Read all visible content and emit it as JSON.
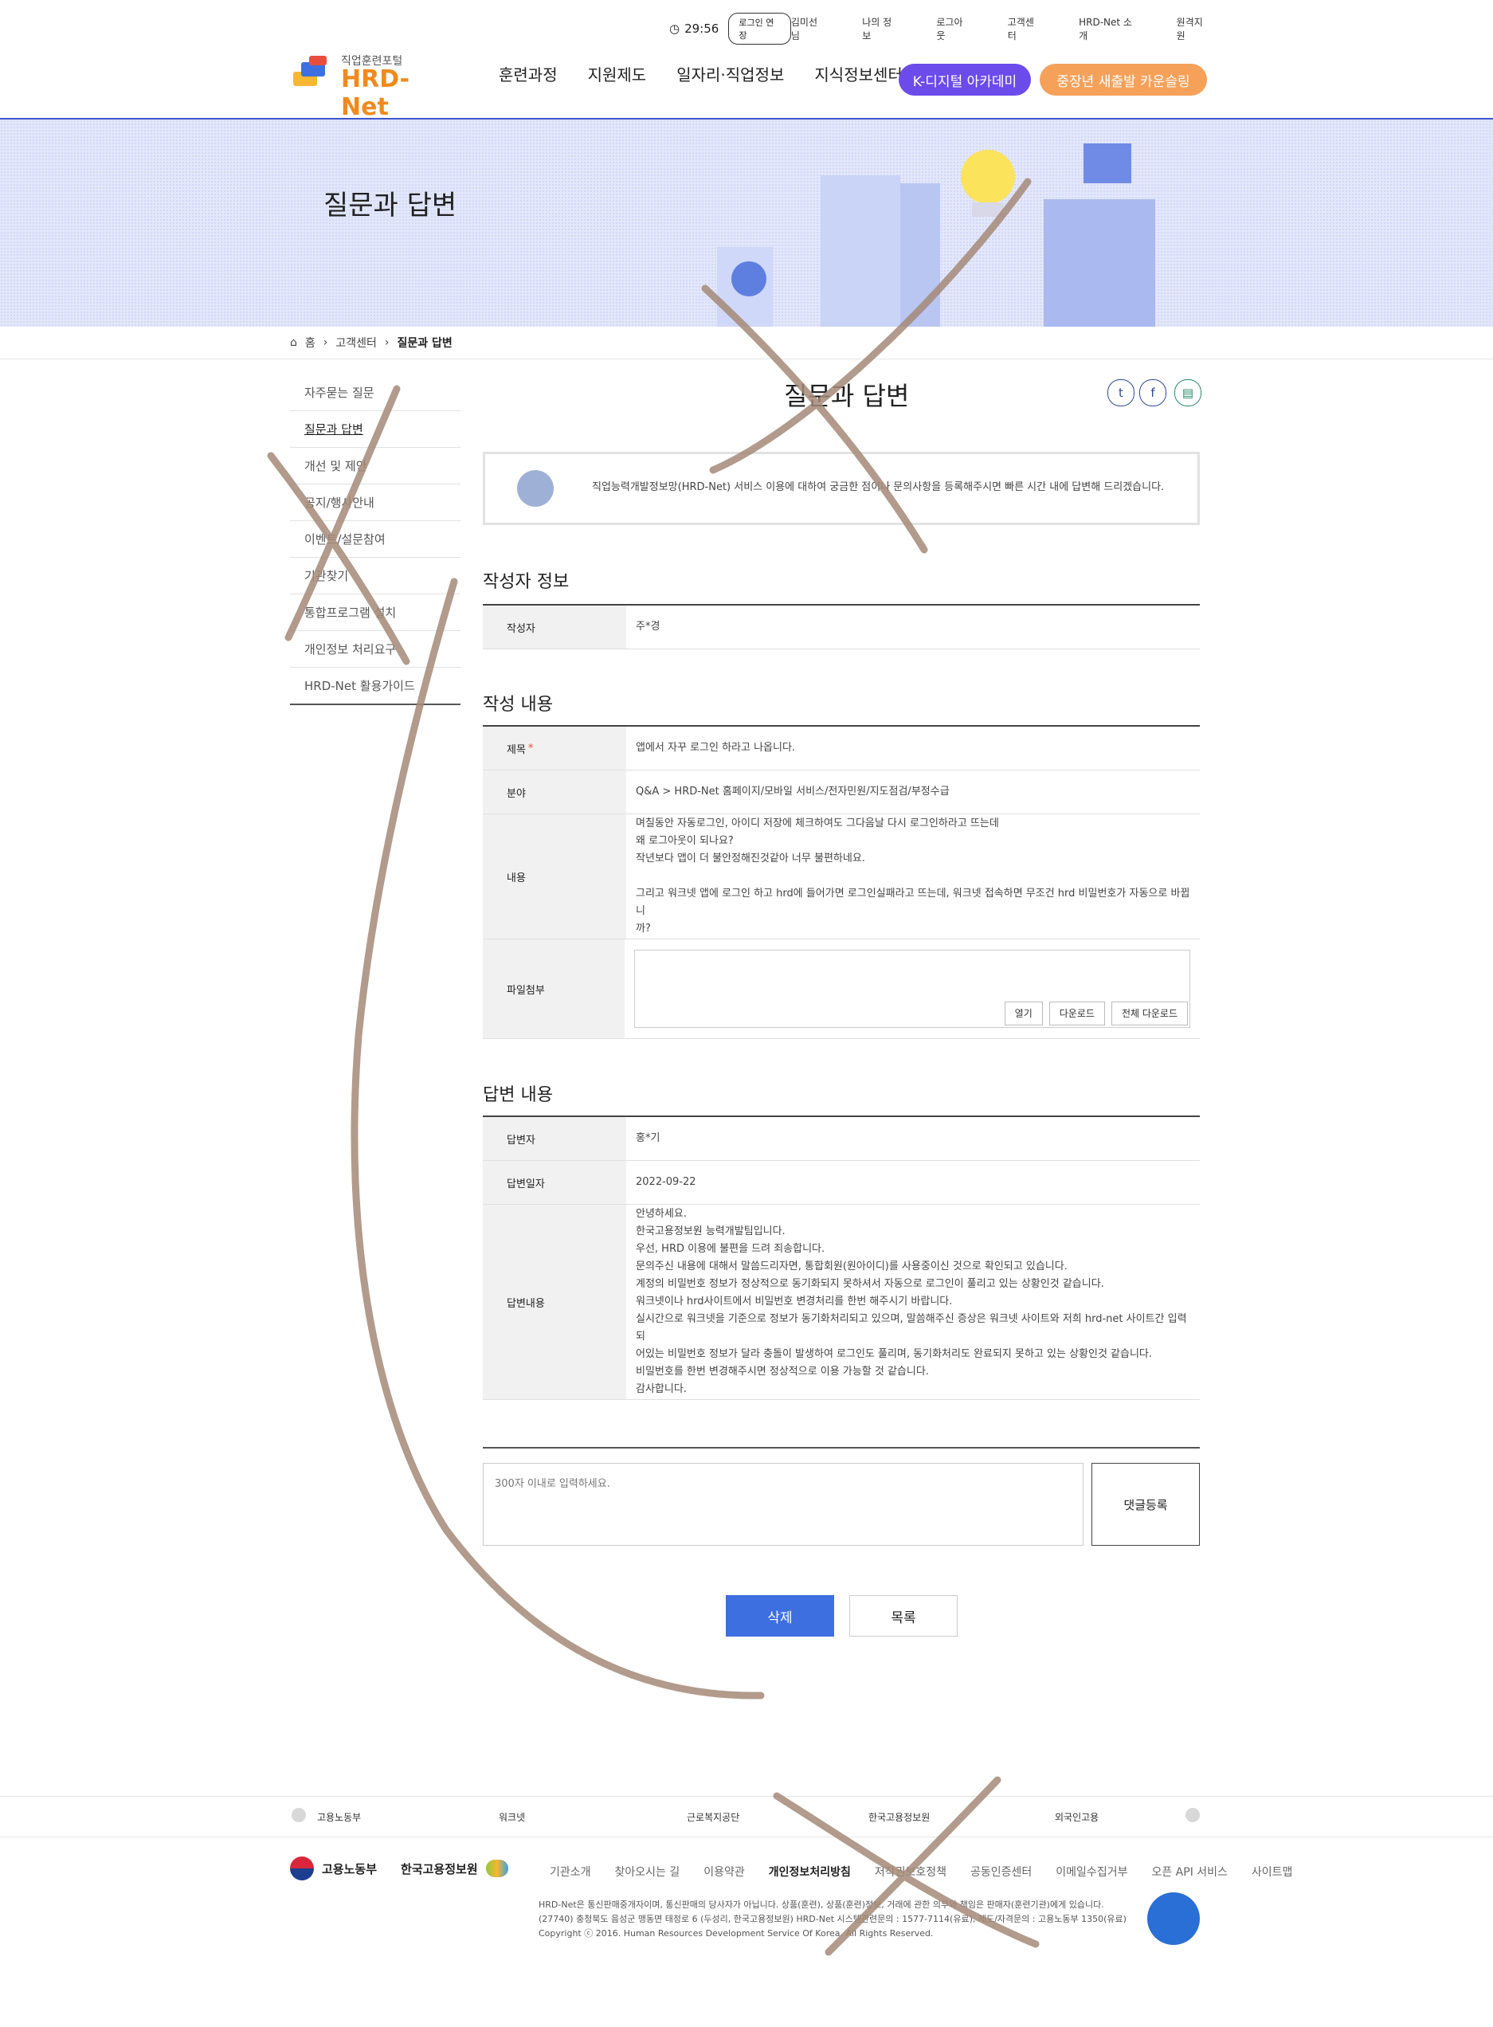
{
  "util": {
    "time": "29:56",
    "extend": "로그인 연장",
    "links": [
      "김미선님",
      "나의 정보",
      "로그아웃",
      "고객센터",
      "HRD-Net 소개",
      "원격지원"
    ]
  },
  "logo": {
    "sub": "직업훈련포털",
    "main": "HRD-Net"
  },
  "gnb": [
    "훈련과정",
    "지원제도",
    "일자리·직업정보",
    "지식정보센터"
  ],
  "pills": {
    "k": "K-디지털 아카데미",
    "s": "중장년 새출발 카운슬링"
  },
  "banner_title": "질문과 답변",
  "breadcrumb": {
    "home": "홈",
    "mid": "고객센터",
    "cur": "질문과 답변"
  },
  "lnb": [
    "자주묻는 질문",
    "질문과 답변",
    "개선 및 제안",
    "공지/행사안내",
    "이벤트/설문참여",
    "기관찾기",
    "통합프로그램 설치",
    "개인정보 처리요구",
    "HRD-Net 활용가이드"
  ],
  "content_title": "질문과 답변",
  "notice": "직업능력개발정보망(HRD-Net) 서비스 이용에 대하여 궁금한 점이나 문의사항을 등록해주시면 빠른 시간 내에 답변해 드리겠습니다.",
  "writer": {
    "section": "작성자 정보",
    "label": "작성자",
    "value": "주*경"
  },
  "post": {
    "section": "작성 내용",
    "title_label": "제목",
    "title_value": "앱에서 자꾸 로그인 하라고 나옵니다.",
    "field_label": "분야",
    "field_value": "Q&A > HRD-Net 홈페이지/모바일 서비스/전자민원/지도점검/부정수급",
    "body_label": "내용",
    "body_lines": [
      "며칠동안 자동로그인, 아이디 저장에 체크하여도 그다음날 다시 로그인하라고 뜨는데",
      "왜 로그아웃이 되나요?",
      "작년보다 앱이 더 불안정해진것같아 너무 불편하네요.",
      "",
      "그리고 워크넷 앱에 로그인 하고 hrd에 들어가면 로그인실패라고 뜨는데, 워크넷 접속하면 무조건 hrd 비밀번호가 자동으로 바뀝니",
      "까?"
    ],
    "file_label": "파일첨부",
    "file_buttons": [
      "열기",
      "다운로드",
      "전체 다운로드"
    ]
  },
  "answer": {
    "section": "답변 내용",
    "by_label": "답변자",
    "by_value": "홍*기",
    "date_label": "답변일자",
    "date_value": "2022-09-22",
    "body_label": "답변내용",
    "body_lines": [
      "안녕하세요.",
      "한국고용정보원 능력개발팀입니다.",
      "우선, HRD 이용에 불편을 드려 죄송합니다.",
      "문의주신 내용에 대해서 말씀드리자면, 통합회원(원아이디)를 사용중이신 것으로 확인되고 있습니다.",
      "계정의 비밀번호 정보가 정상적으로 동기화되지 못하셔서 자동으로 로그인이 풀리고 있는 상황인것 같습니다.",
      "워크넷이나 hrd사이트에서 비밀번호 변경처리를 한번 해주시기 바랍니다.",
      "실시간으로 워크넷을 기준으로 정보가 동기화처리되고 있으며, 말씀해주신 증상은 워크넷 사이트와 저희 hrd-net 사이트간 입력되",
      "어있는 비밀번호 정보가 달라 충돌이 발생하여 로그인도 풀리며, 동기화처리도 완료되지 못하고 있는 상황인것 같습니다.",
      "비밀번호를 한번 변경해주시면 정상적으로 이용 가능할 것 같습니다.",
      "감사합니다."
    ]
  },
  "comment": {
    "placeholder": "300자 이내로 입력하세요.",
    "button": "댓글등록"
  },
  "buttons": {
    "delete": "삭제",
    "list": "목록"
  },
  "family_sites": [
    "고용노동부",
    "워크넷",
    "근로복지공단",
    "한국고용정보원",
    "외국인고용"
  ],
  "footer": {
    "org1": "고용노동부",
    "org2": "한국고용정보원",
    "links": [
      "기관소개",
      "찾아오시는 길",
      "이용약관",
      "개인정보처리방침",
      "저작권보호정책",
      "공동인증센터",
      "이메일수집거부",
      "오픈 API 서비스",
      "사이트맵"
    ],
    "info1": "HRD-Net은 통신판매중개자이며, 통신판매의 당사자가 아닙니다. 상품(훈련), 상품(훈련)정보, 거래에 관한 의무와 책임은 판매자(훈련기관)에게 있습니다.",
    "info2": "(27740) 충청북도 음성군 맹동면 태정로 6 (두성리, 한국고용정보원) HRD-Net 시스템관련문의 : 1577-7114(유료), 제도/자격문의 : 고용노동부 1350(유료)",
    "copyright": "Copyright ⓒ 2016. Human Resources Development Service Of Korea. All Rights Reserved."
  },
  "colors": {
    "primary": "#3e6fe0",
    "k_pill": "#6b4bea",
    "s_pill": "#f5a15a",
    "pen": "#a58a78"
  }
}
